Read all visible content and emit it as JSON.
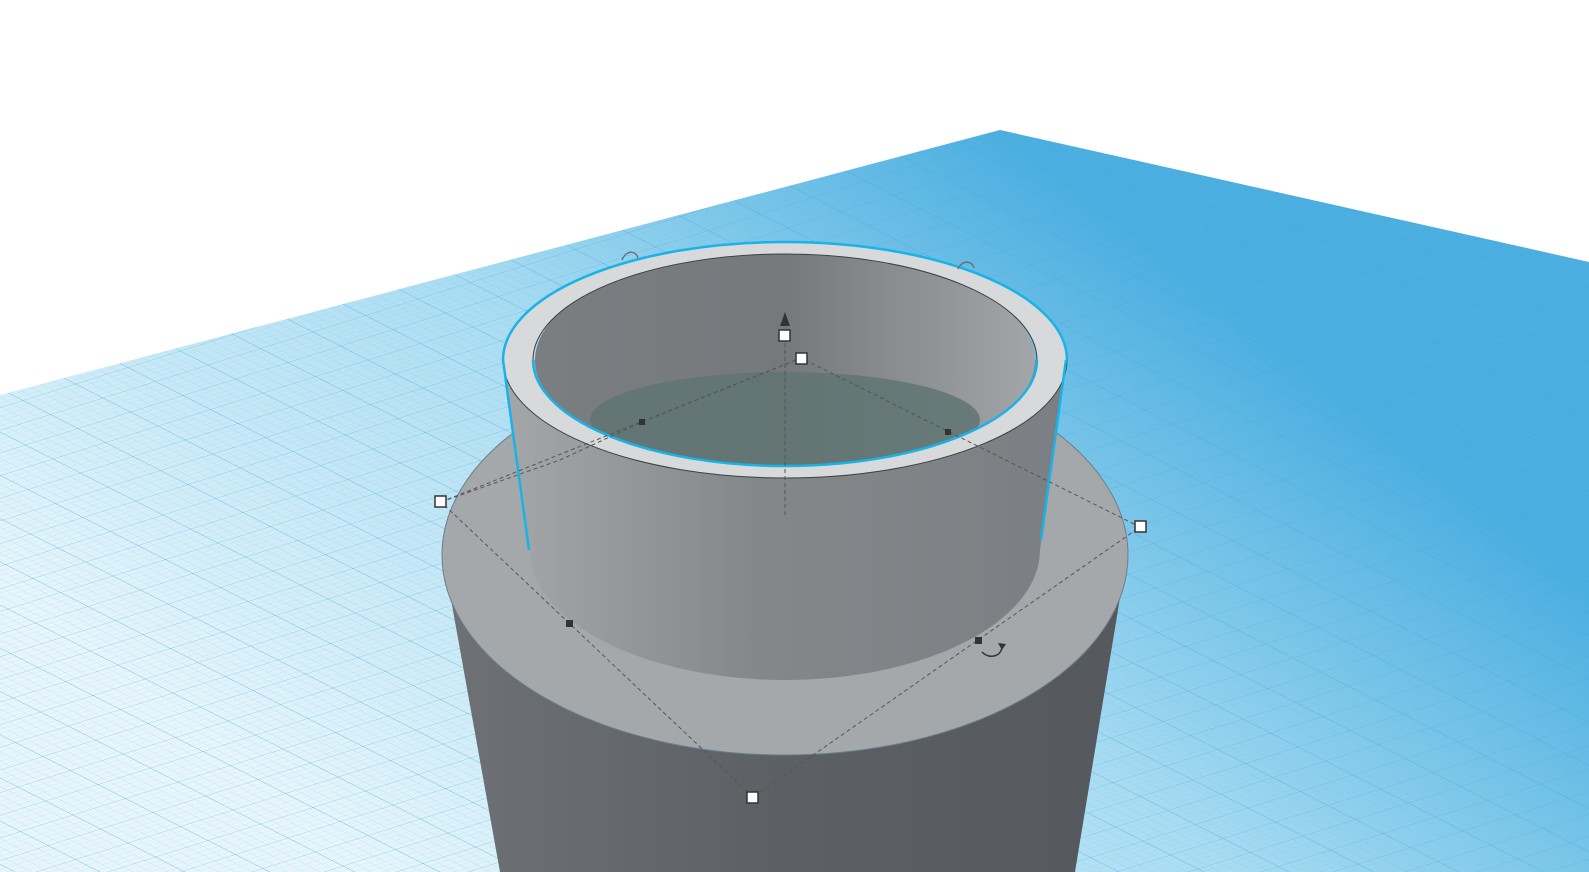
{
  "workplane": {
    "grid_color": "#5fb8dd",
    "plane_color_far": "#4fb3e0",
    "plane_color_near": "#eaf7fc",
    "background": "#ffffff"
  },
  "shapes": [
    {
      "name": "base-cylinder",
      "color_top": "#a5a8ab",
      "color_side": "#5e6266"
    },
    {
      "name": "hollow-ring",
      "color_rim": "#d7d9db",
      "color_outer": "#8e9194",
      "color_inner": "#7d8184",
      "highlight": "#19b3e6"
    }
  ],
  "gizmo": {
    "icons": [
      "up-arrow-icon",
      "rotate-arrow-icon"
    ],
    "handle_color": "#ffffff",
    "handle_stroke": "#333333",
    "guide_color": "#555555"
  }
}
